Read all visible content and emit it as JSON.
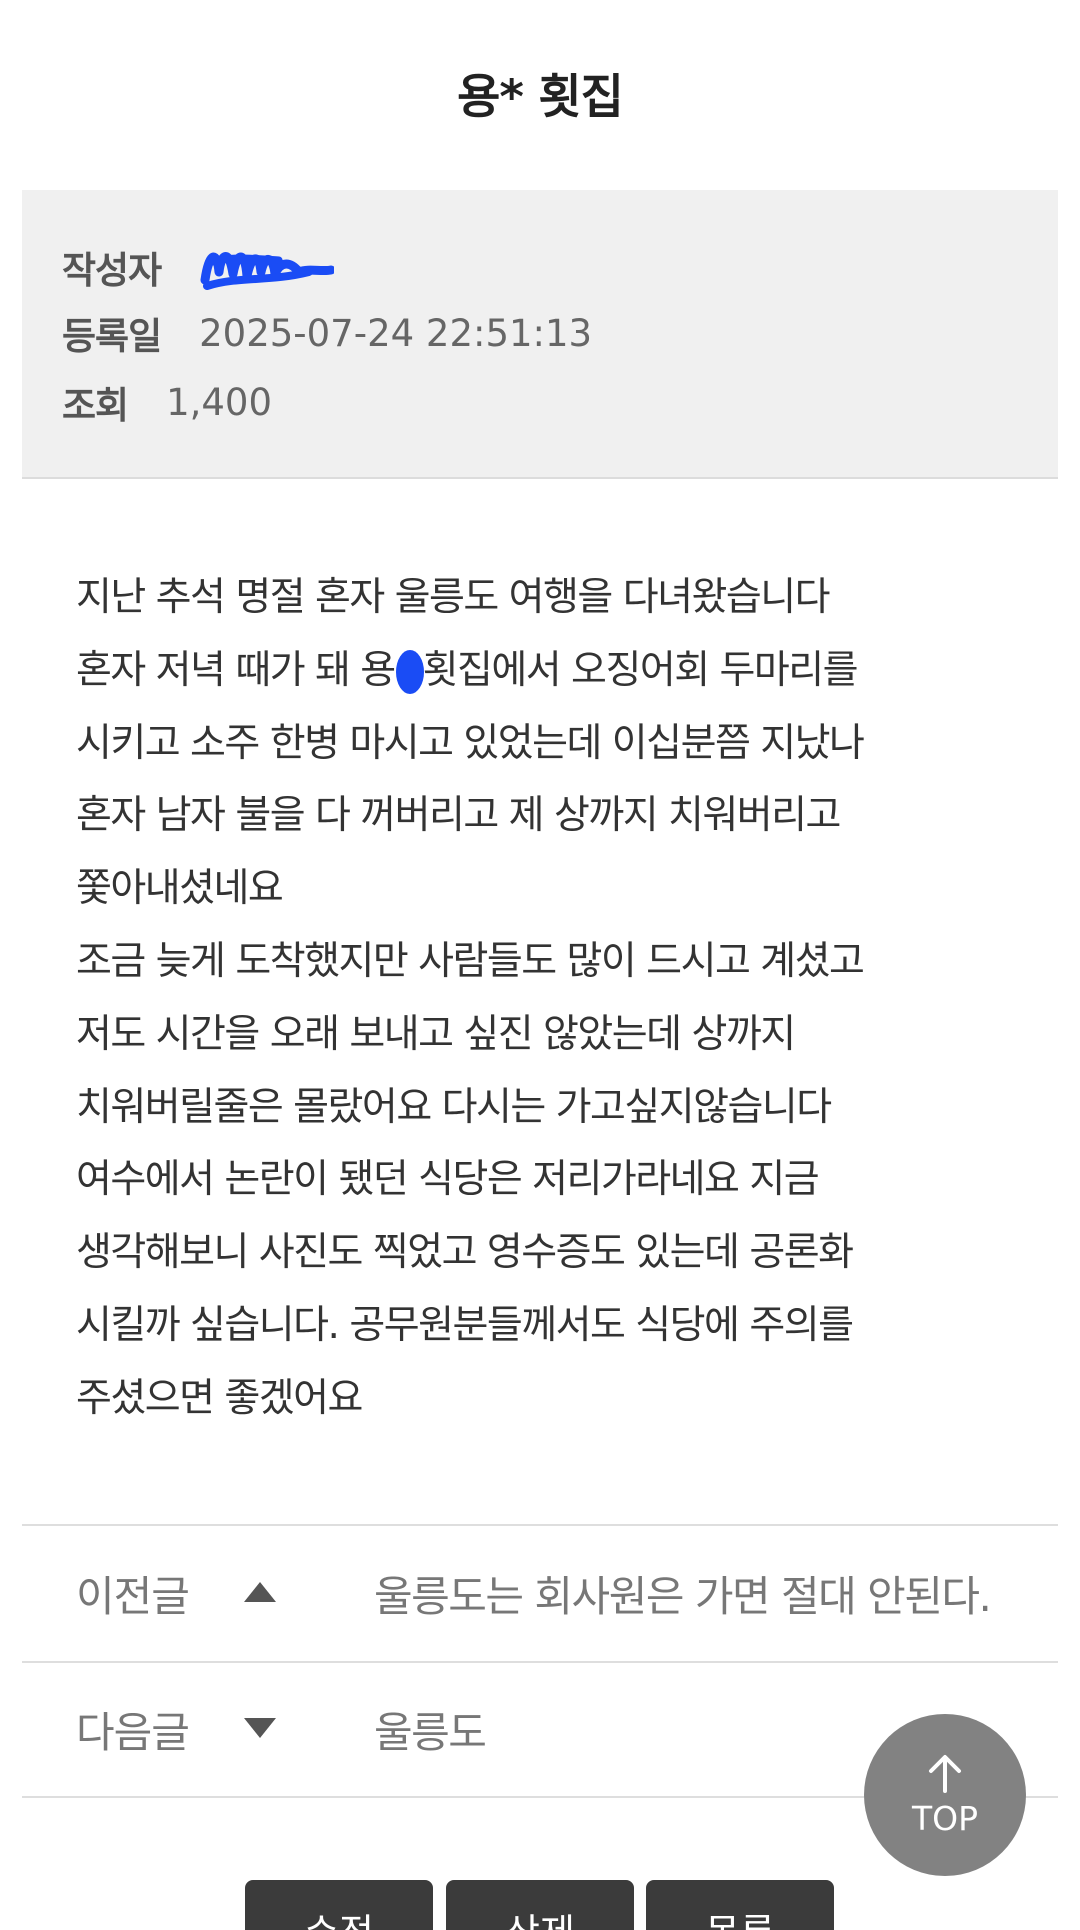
{
  "post": {
    "title": "용* 횟집",
    "meta": {
      "author_label": "작성자",
      "date_label": "등록일",
      "date_value": "2025-07-24 22:51:13",
      "views_label": "조회",
      "views_value": "1,400"
    },
    "body_lines": [
      "지난 추석 명절 혼자 울릉도 여행을 다녀왔습니다",
      "혼자 저녁 때가 돼 용",
      "횟집에서 오징어회 두마리를",
      "시키고 소주 한병 마시고 있었는데 이십분쯤 지났나",
      "혼자 남자 불을 다 꺼버리고 제 상까지 치워버리고",
      "쫓아내셨네요",
      "조금 늦게 도착했지만 사람들도 많이 드시고 계셨고",
      "저도 시간을 오래 보내고 싶진 않았는데 상까지",
      "치워버릴줄은 몰랐어요 다시는 가고싶지않습니다",
      "여수에서 논란이 됐던 식당은 저리가라네요 지금",
      "생각해보니 사진도 찍었고 영수증도 있는데 공론화",
      "시킬까 싶습니다. 공무원분들께서도 식당에 주의를",
      "주셨으면 좋겠어요"
    ]
  },
  "navigation": {
    "prev_label": "이전글",
    "prev_title": "울릉도는 회사원은 가면 절대 안된다.",
    "next_label": "다음글",
    "next_title": "울릉도"
  },
  "top_button": {
    "label": "TOP",
    "icon": "arrow-up-icon"
  },
  "actions": {
    "edit_label": "수정",
    "delete_label": "삭제",
    "list_label": "목록"
  },
  "colors": {
    "meta_background": "#f0f0f0",
    "redaction_blue": "#1a4cf5",
    "top_button": "#828282",
    "action_button": "#3b3b3b"
  }
}
